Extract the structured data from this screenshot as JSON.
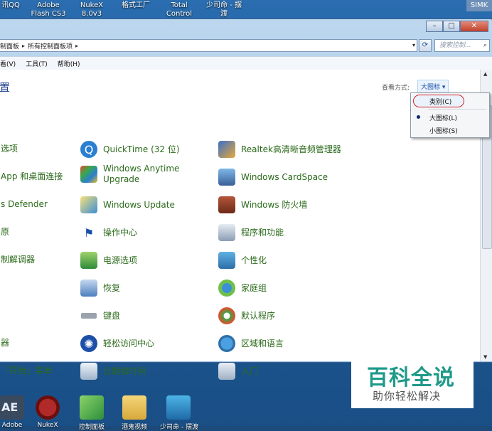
{
  "desktop": {
    "top_icons": [
      {
        "label": "讯QQ"
      },
      {
        "label": "Adobe Flash CS3"
      },
      {
        "label": "NukeX 8.0v3"
      },
      {
        "label": "格式工厂"
      },
      {
        "label": "Total Control"
      },
      {
        "label": "少司命 - 摆渡"
      }
    ],
    "corner_label": "SIMK",
    "bottom_icons": [
      {
        "label": "Adobe"
      },
      {
        "label": "NukeX"
      },
      {
        "label": "控制面板"
      },
      {
        "label": "酒鬼视频"
      },
      {
        "label": "少司命 - 摆渡"
      }
    ]
  },
  "window": {
    "caption": {
      "minimize": "–",
      "maximize": "□",
      "close": "✕"
    },
    "address": {
      "crumbs": [
        "制面板",
        "所有控制面板项"
      ],
      "search_placeholder": "搜索控制..."
    },
    "menu": [
      "查看(V)",
      "工具(T)",
      "帮助(H)"
    ],
    "page_title": "置",
    "view_by": {
      "label": "查看方式:",
      "value": "大图标 ▾"
    },
    "dropdown": {
      "options": [
        {
          "label": "类别(C)",
          "highlighted": true
        },
        {
          "label": "大图标(L)",
          "selected": true
        },
        {
          "label": "小图标(S)"
        }
      ]
    },
    "items": {
      "col1": [
        "选项",
        "App 和桌面连接",
        "s Defender",
        "原",
        "制解调器",
        "器",
        "「开始」菜单"
      ],
      "col2": [
        "QuickTime (32 位)",
        "Windows Anytime Upgrade",
        "Windows Update",
        "操作中心",
        "电源选项",
        "恢复",
        "键盘",
        "轻松访问中心",
        "日期和时间"
      ],
      "col3": [
        "Realtek高清晰音频管理器",
        "Windows CardSpace",
        "Windows 防火墙",
        "程序和功能",
        "个性化",
        "家庭组",
        "默认程序",
        "区域和语言",
        "入门"
      ]
    }
  },
  "watermark": {
    "title": "百科全说",
    "subtitle": "助你轻松解决"
  },
  "colors": {
    "link_green": "#2b6a1a",
    "title_blue": "#1e3f8a",
    "watermark_teal": "#1f9a8a",
    "highlight_red": "#d4232a"
  }
}
